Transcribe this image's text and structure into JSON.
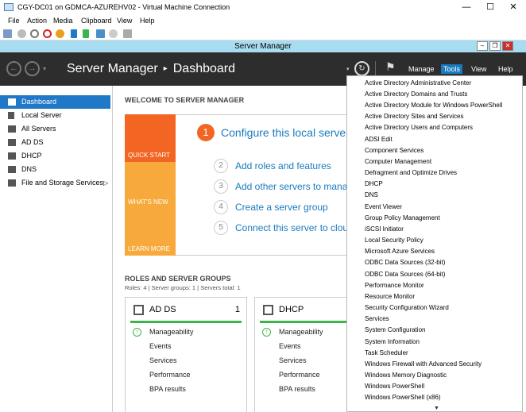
{
  "host_window": {
    "title": "CGY-DC01 on GDMCA-AZUREHV02 - Virtual Machine Connection",
    "controls": [
      "—",
      "☐",
      "✕"
    ],
    "menu": [
      "File",
      "Action",
      "Media",
      "Clipboard",
      "View",
      "Help"
    ]
  },
  "server_manager": {
    "title": "Server Manager",
    "breadcrumb": {
      "app": "Server Manager",
      "separator": "▸",
      "page": "Dashboard"
    },
    "header_menu": [
      "Manage",
      "Tools",
      "View",
      "Help"
    ]
  },
  "sidebar": {
    "items": [
      {
        "label": "Dashboard",
        "icon": "dashboard-icon",
        "active": true
      },
      {
        "label": "Local Server",
        "icon": "server-icon"
      },
      {
        "label": "All Servers",
        "icon": "servers-icon"
      },
      {
        "label": "AD DS",
        "icon": "ad-ds-icon"
      },
      {
        "label": "DHCP",
        "icon": "dhcp-icon"
      },
      {
        "label": "DNS",
        "icon": "dns-icon"
      },
      {
        "label": "File and Storage Services",
        "icon": "storage-icon",
        "expander": "▷"
      }
    ]
  },
  "welcome": {
    "heading": "WELCOME TO SERVER MANAGER",
    "tiles": [
      "QUICK START",
      "WHAT'S NEW",
      "LEARN MORE"
    ],
    "primary_step": {
      "number": "1",
      "text": "Configure this local serve"
    },
    "steps": [
      {
        "number": "2",
        "text": "Add roles and features"
      },
      {
        "number": "3",
        "text": "Add other servers to manag"
      },
      {
        "number": "4",
        "text": "Create a server group"
      },
      {
        "number": "5",
        "text": "Connect this server to cloud"
      }
    ]
  },
  "roles": {
    "heading": "ROLES AND SERVER GROUPS",
    "summary": "Roles: 4   |   Server groups: 1   |   Servers total: 1",
    "cards": [
      {
        "title": "AD DS",
        "count": "1",
        "rows": [
          "Manageability",
          "Events",
          "Services",
          "Performance",
          "BPA results"
        ]
      },
      {
        "title": "DHCP",
        "count": "",
        "rows": [
          "Manageability",
          "Events",
          "Services",
          "Performance",
          "BPA results"
        ]
      }
    ]
  },
  "tools_menu": {
    "items": [
      "Active Directory Administrative Center",
      "Active Directory Domains and Trusts",
      "Active Directory Module for Windows PowerShell",
      "Active Directory Sites and Services",
      "Active Directory Users and Computers",
      "ADSI Edit",
      "Component Services",
      "Computer Management",
      "Defragment and Optimize Drives",
      "DHCP",
      "DNS",
      "Event Viewer",
      "Group Policy Management",
      "iSCSI Initiator",
      "Local Security Policy",
      "Microsoft Azure Services",
      "ODBC Data Sources (32-bit)",
      "ODBC Data Sources (64-bit)",
      "Performance Monitor",
      "Resource Monitor",
      "Security Configuration Wizard",
      "Services",
      "System Configuration",
      "System Information",
      "Task Scheduler",
      "Windows Firewall with Advanced Security",
      "Windows Memory Diagnostic",
      "Windows PowerShell",
      "Windows PowerShell (x86)"
    ],
    "more_indicator": "▼"
  },
  "colors": {
    "header_bg": "#2d2d2d",
    "accent_blue": "#1f78c8",
    "quick_start": "#f26522",
    "whats_new": "#f7a93b",
    "learn_more": "#f7a93b",
    "status_green": "#3bb54a",
    "sm_titlebar": "#a8dcf0"
  }
}
